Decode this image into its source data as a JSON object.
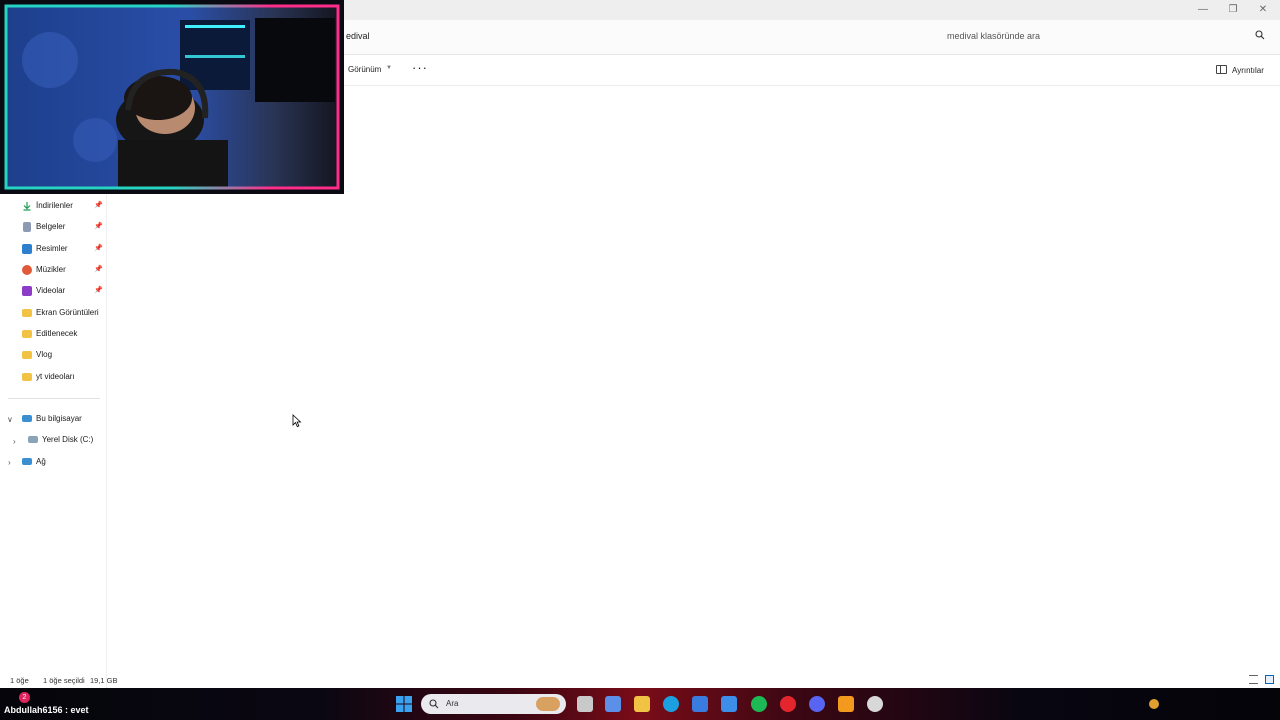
{
  "address": {
    "path_text": "edival"
  },
  "search": {
    "placeholder": "medival klasöründe ara"
  },
  "toolbar": {
    "view_label": "Görünüm",
    "more_label": "···",
    "details_label": "Ayrıntılar"
  },
  "sidebar": {
    "quick_access": [
      {
        "label": "İndirilenler",
        "icon": "downloads-icon",
        "pinned": true,
        "color": "#1f9c55"
      },
      {
        "label": "Belgeler",
        "icon": "documents-icon",
        "pinned": true,
        "color": "#7d8da6"
      },
      {
        "label": "Resimler",
        "icon": "pictures-icon",
        "pinned": true,
        "color": "#2f7fcf"
      },
      {
        "label": "Müzikler",
        "icon": "music-icon",
        "pinned": true,
        "color": "#e05a3a"
      },
      {
        "label": "Videolar",
        "icon": "videos-icon",
        "pinned": true,
        "color": "#8c3cc7"
      },
      {
        "label": "Ekran Görüntüleri",
        "icon": "folder-icon",
        "pinned": false,
        "color": "#f2c245"
      },
      {
        "label": "Editlenecek",
        "icon": "folder-icon",
        "pinned": false,
        "color": "#f2c245"
      },
      {
        "label": "Vlog",
        "icon": "folder-icon",
        "pinned": false,
        "color": "#f2c245"
      },
      {
        "label": "yt videoları",
        "icon": "folder-icon",
        "pinned": false,
        "color": "#f2c245"
      }
    ],
    "this_pc": {
      "label": "Bu bilgisayar",
      "icon": "computer-icon"
    },
    "local_disk": {
      "label": "Yerel Disk (C:)",
      "icon": "drive-icon"
    },
    "network": {
      "label": "Ağ",
      "icon": "network-icon"
    }
  },
  "status": {
    "item_count": "1 öğe",
    "selected": "1 öğe seçildi",
    "size": "19,1 GB"
  },
  "taskbar": {
    "search_label": "Ara",
    "apps": [
      {
        "name": "file-manager-icon",
        "color": "#c9c9c9"
      },
      {
        "name": "widgets-icon",
        "color": "#5b8fe8"
      },
      {
        "name": "explorer-icon",
        "color": "#f2c245"
      },
      {
        "name": "edge-icon",
        "color": "#1ba1e2"
      },
      {
        "name": "store-icon",
        "color": "#3a7be0"
      },
      {
        "name": "mail-icon",
        "color": "#3d8ee8"
      },
      {
        "name": "spotify-icon",
        "color": "#1db954"
      },
      {
        "name": "opera-icon",
        "color": "#e3262d"
      },
      {
        "name": "discord-icon",
        "color": "#5865f2"
      },
      {
        "name": "premiere-icon",
        "color": "#f39a1e"
      },
      {
        "name": "obs-icon",
        "color": "#d8d8d8"
      }
    ]
  },
  "stream_overlay": {
    "chat_user": "Abdullah6156 : evet",
    "chat_badge": "2"
  },
  "colors": {
    "accent": "#0067c0",
    "webcam_frame_left": "#26d4c4",
    "webcam_frame_right": "#ff2d8a"
  }
}
